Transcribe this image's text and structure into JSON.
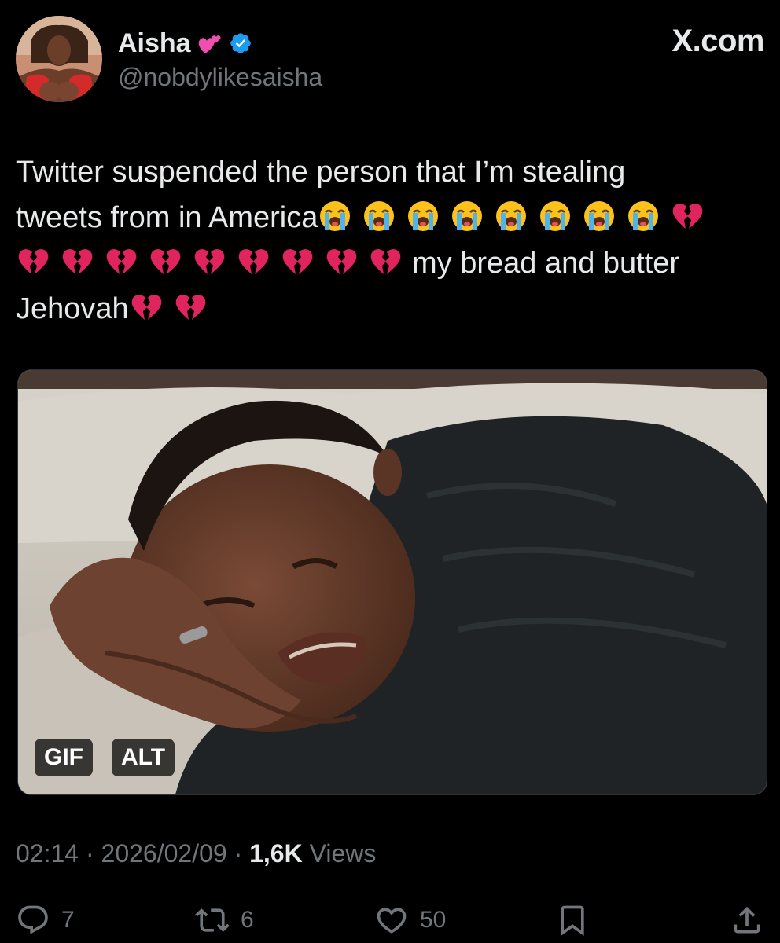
{
  "brand": "X.com",
  "author": {
    "display_name": "Aisha",
    "name_emoji": "two-hearts-icon",
    "verified_icon": "verified-badge-icon",
    "handle": "@nobdylikesaisha"
  },
  "tweet": {
    "line1_text": "Twitter suspended the person that I’m stealing",
    "line2_text": "tweets from in America",
    "line3_text": "my bread and butter",
    "line4_text": "Jehovah",
    "line2_emojis": [
      "loudly-crying-face-icon",
      "loudly-crying-face-icon",
      "loudly-crying-face-icon",
      "loudly-crying-face-icon",
      "loudly-crying-face-icon",
      "loudly-crying-face-icon",
      "loudly-crying-face-icon",
      "loudly-crying-face-icon",
      "broken-heart-icon"
    ],
    "line3_emojis": [
      "broken-heart-icon",
      "broken-heart-icon",
      "broken-heart-icon",
      "broken-heart-icon",
      "broken-heart-icon",
      "broken-heart-icon",
      "broken-heart-icon",
      "broken-heart-icon",
      "broken-heart-icon"
    ],
    "line4_emojis": [
      "broken-heart-icon",
      "broken-heart-icon"
    ]
  },
  "media": {
    "gif_badge": "GIF",
    "alt_badge": "ALT"
  },
  "meta": {
    "time": "02:14",
    "separator": "·",
    "date": "2026/02/09",
    "views_count": "1,6K",
    "views_label": "Views"
  },
  "actions": {
    "reply_count": "7",
    "retweet_count": "6",
    "like_count": "50"
  },
  "colors": {
    "background": "#000000",
    "text": "#e7e9ea",
    "muted": "#71767b",
    "verified": "#1d9bf0",
    "heart": "#e0245e"
  }
}
